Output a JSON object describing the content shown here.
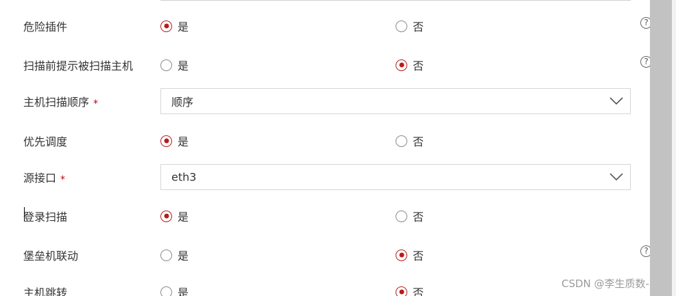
{
  "rows": [
    {
      "label": "危险插件",
      "required": false,
      "type": "radio",
      "yes": "是",
      "no": "否",
      "selected": "yes",
      "help": true
    },
    {
      "label": "扫描前提示被扫描主机",
      "required": false,
      "type": "radio",
      "yes": "是",
      "no": "否",
      "selected": "no",
      "help": true
    },
    {
      "label": "主机扫描顺序",
      "required": true,
      "type": "select",
      "value": "顺序",
      "help": false
    },
    {
      "label": "优先调度",
      "required": false,
      "type": "radio",
      "yes": "是",
      "no": "否",
      "selected": "yes",
      "help": false
    },
    {
      "label": "源接口",
      "required": true,
      "type": "select",
      "value": "eth3",
      "help": false
    },
    {
      "label": "登录扫描",
      "required": false,
      "type": "radio",
      "yes": "是",
      "no": "否",
      "selected": "yes",
      "help": false
    },
    {
      "label": "堡垒机联动",
      "required": false,
      "type": "radio",
      "yes": "是",
      "no": "否",
      "selected": "no",
      "help": true
    },
    {
      "label": "主机跳转",
      "required": false,
      "type": "radio",
      "yes": "是",
      "no": "否",
      "selected": "no",
      "help": false
    }
  ],
  "required_mark": "*",
  "help_glyph": "?",
  "colors": {
    "accent": "#b71c1c",
    "required": "#c00000",
    "scrollbar": "#c4c4c4"
  },
  "watermark": "CSDN @李生质数-"
}
